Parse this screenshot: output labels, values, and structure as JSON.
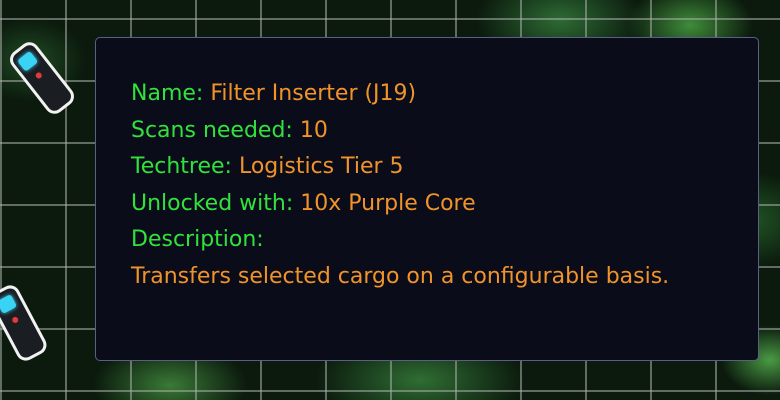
{
  "tooltip": {
    "name_label": "Name:",
    "name_value": "Filter Inserter (J19)",
    "scans_label": "Scans needed:",
    "scans_value": "10",
    "techtree_label": "Techtree:",
    "techtree_value": "Logistics Tier 5",
    "unlock_label": "Unlocked with:",
    "unlock_value": "10x Purple Core",
    "description_label": "Description:",
    "description_value": "Transfers selected cargo on a configurable basis."
  },
  "colors": {
    "label": "#31e23c",
    "value": "#f0932b",
    "panel_bg": "#0b0c19",
    "panel_border": "#5a5f86",
    "scanner_screen": "#39d3f5"
  },
  "icons": [
    "scanner-icon",
    "scanner-icon"
  ]
}
